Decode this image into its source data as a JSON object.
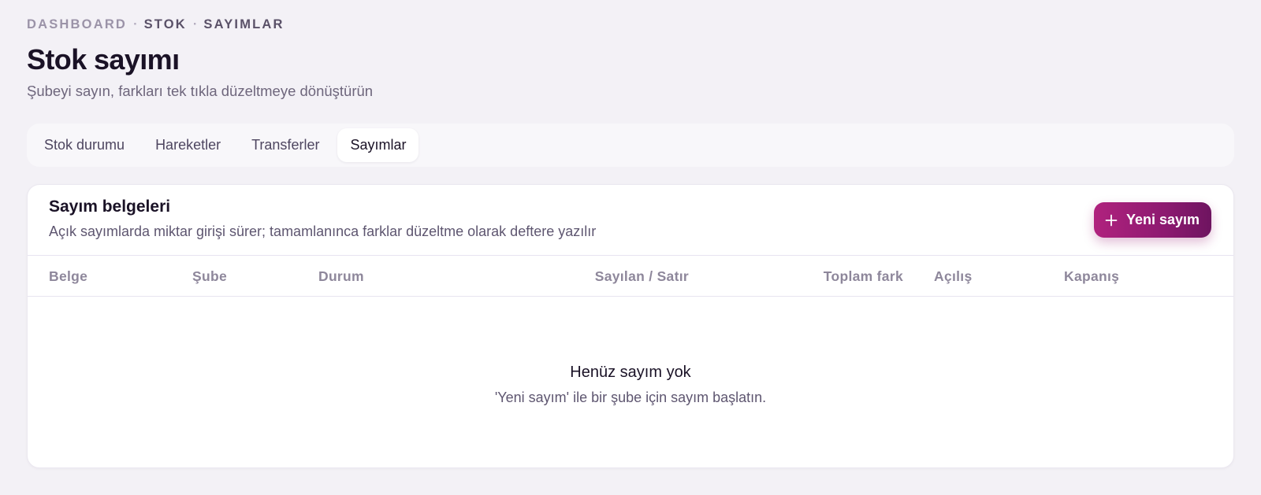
{
  "breadcrumb": {
    "items": [
      "DASHBOARD",
      "STOK",
      "SAYIMLAR"
    ],
    "separator": "·"
  },
  "header": {
    "title": "Stok sayımı",
    "subtitle": "Şubeyi sayın, farkları tek tıkla düzeltmeye dönüştürün"
  },
  "tabs": [
    {
      "label": "Stok durumu",
      "active": false
    },
    {
      "label": "Hareketler",
      "active": false
    },
    {
      "label": "Transferler",
      "active": false
    },
    {
      "label": "Sayımlar",
      "active": true
    }
  ],
  "card": {
    "title": "Sayım belgeleri",
    "description": "Açık sayımlarda miktar girişi sürer; tamamlanınca farklar düzeltme olarak deftere yazılır",
    "new_button_label": "Yeni sayım",
    "new_button_icon": "plus-icon"
  },
  "table": {
    "columns": [
      "Belge",
      "Şube",
      "Durum",
      "Sayılan / Satır",
      "Toplam fark",
      "Açılış",
      "Kapanış"
    ],
    "rows": []
  },
  "empty_state": {
    "title": "Henüz sayım yok",
    "description": "'Yeni sayım' ile bir şube için sayım başlatın."
  },
  "colors": {
    "accent": "#a11f78",
    "background": "#f3f1f6"
  }
}
